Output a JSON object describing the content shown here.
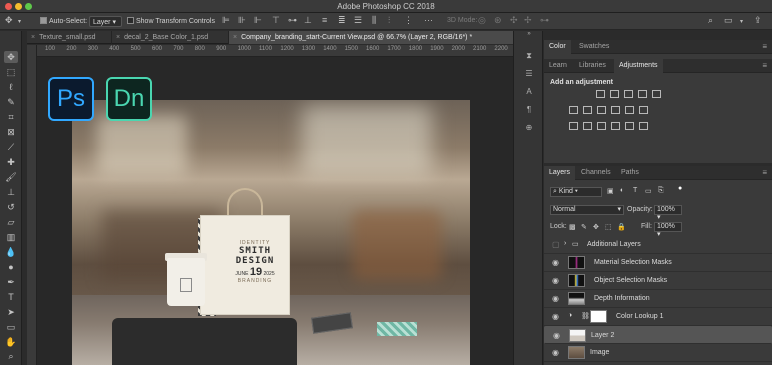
{
  "window": {
    "title": "Adobe Photoshop CC 2018"
  },
  "options_bar": {
    "auto_select_label": "Auto-Select:",
    "auto_select_value": "Layer",
    "show_transform_label": "Show Transform Controls",
    "mode_3d_label": "3D Mode:"
  },
  "tabs": [
    {
      "label": "Texture_small.psd",
      "active": false
    },
    {
      "label": "decal_2_Base Color_1.psd",
      "active": false
    },
    {
      "label": "Company_branding_start-Current View.psd @ 66.7% (Layer 2, RGB/16*) *",
      "active": true
    }
  ],
  "ruler_ticks": [
    "100",
    "200",
    "300",
    "400",
    "500",
    "600",
    "700",
    "800",
    "900",
    "1000",
    "1100",
    "1200",
    "1300",
    "1400",
    "1500",
    "1600",
    "1700",
    "1800",
    "1900",
    "2000",
    "2100",
    "2200"
  ],
  "app_icons": {
    "ps": "Ps",
    "dn": "Dn"
  },
  "bag_logo": {
    "line1": "IDENTITY",
    "name": "SMITH DESIGN",
    "date_prefix": "JUNE",
    "date_day": "19",
    "date_year": "2025",
    "line5": "BRANDING"
  },
  "color_panel": {
    "tabs": [
      "Color",
      "Swatches"
    ],
    "active_tab": "Color"
  },
  "adjustments_panel": {
    "tabs": [
      "Learn",
      "Libraries",
      "Adjustments"
    ],
    "active_tab": "Adjustments",
    "heading": "Add an adjustment"
  },
  "layers_panel": {
    "tabs": [
      "Layers",
      "Channels",
      "Paths"
    ],
    "active_tab": "Layers",
    "filter_kind": "Kind",
    "blend_mode": "Normal",
    "opacity_label": "Opacity:",
    "opacity_value": "100%",
    "lock_label": "Lock:",
    "fill_label": "Fill:",
    "fill_value": "100%",
    "layers": [
      {
        "name": "Additional Layers",
        "type": "group",
        "selected": false
      },
      {
        "name": "Material Selection Masks",
        "type": "layer",
        "selected": false
      },
      {
        "name": "Object Selection Masks",
        "type": "layer",
        "selected": false
      },
      {
        "name": "Depth Information",
        "type": "layer",
        "selected": false
      },
      {
        "name": "Color Lookup 1",
        "type": "adjustment",
        "selected": false
      },
      {
        "name": "Layer 2",
        "type": "layer",
        "selected": true
      },
      {
        "name": "Image",
        "type": "layer",
        "selected": false
      }
    ]
  },
  "colors": {
    "ps_accent": "#31a8ff",
    "dn_accent": "#4ad6b0",
    "ui_bg": "#2b2b2b",
    "panel_bg": "#3a3a3a",
    "selected_layer": "#555555"
  }
}
